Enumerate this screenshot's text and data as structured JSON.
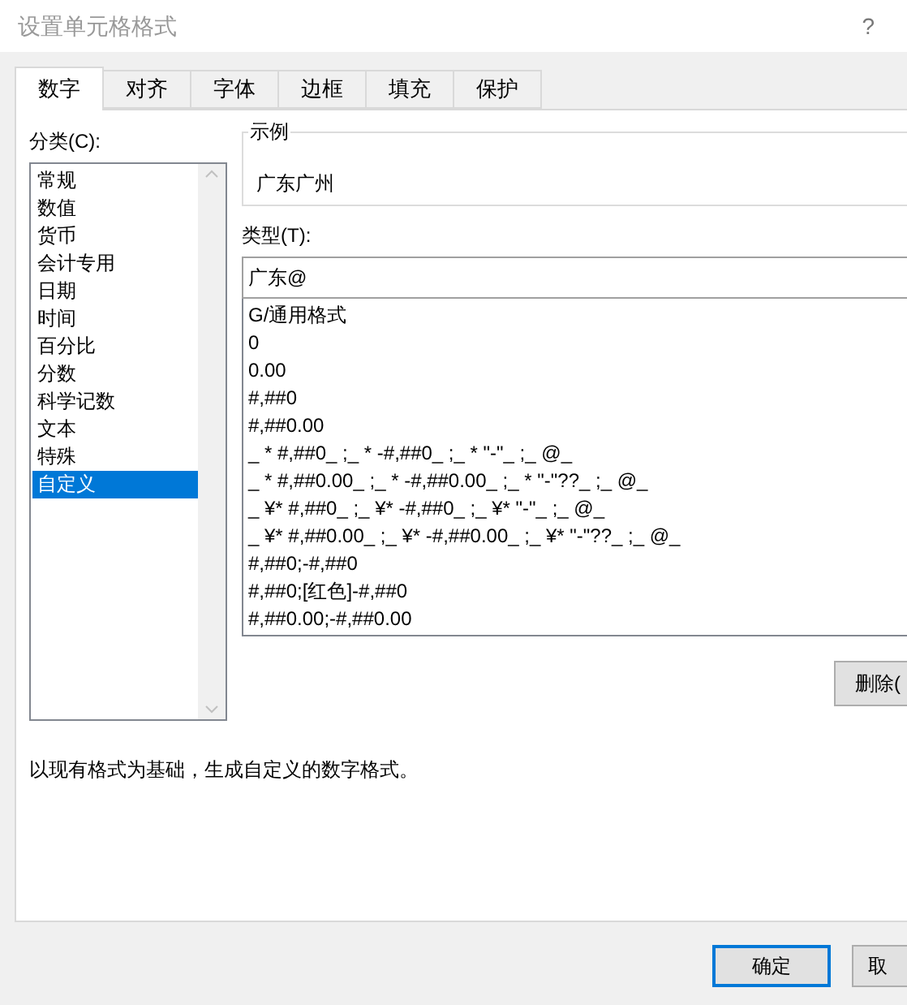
{
  "window": {
    "title": "设置单元格格式",
    "help": "?"
  },
  "tabs": [
    {
      "label": "数字",
      "selected": true
    },
    {
      "label": "对齐",
      "selected": false
    },
    {
      "label": "字体",
      "selected": false
    },
    {
      "label": "边框",
      "selected": false
    },
    {
      "label": "填充",
      "selected": false
    },
    {
      "label": "保护",
      "selected": false
    }
  ],
  "category": {
    "label": "分类(C):",
    "items": [
      {
        "label": "常规",
        "selected": false
      },
      {
        "label": "数值",
        "selected": false
      },
      {
        "label": "货币",
        "selected": false
      },
      {
        "label": "会计专用",
        "selected": false
      },
      {
        "label": "日期",
        "selected": false
      },
      {
        "label": "时间",
        "selected": false
      },
      {
        "label": "百分比",
        "selected": false
      },
      {
        "label": "分数",
        "selected": false
      },
      {
        "label": "科学记数",
        "selected": false
      },
      {
        "label": "文本",
        "selected": false
      },
      {
        "label": "特殊",
        "selected": false
      },
      {
        "label": "自定义",
        "selected": true
      }
    ]
  },
  "sample": {
    "legend": "示例",
    "value": "广东广州"
  },
  "type": {
    "label": "类型(T):",
    "value": "广东@",
    "formats": [
      "G/通用格式",
      "0",
      "0.00",
      "#,##0",
      "#,##0.00",
      "_ * #,##0_ ;_ * -#,##0_ ;_ * \"-\"_ ;_ @_",
      "_ * #,##0.00_ ;_ * -#,##0.00_ ;_ * \"-\"??_ ;_ @_",
      "_ ¥* #,##0_ ;_ ¥* -#,##0_ ;_ ¥* \"-\"_ ;_ @_",
      "_ ¥* #,##0.00_ ;_ ¥* -#,##0.00_ ;_ ¥* \"-\"??_ ;_ @_",
      "#,##0;-#,##0",
      "#,##0;[红色]-#,##0",
      "#,##0.00;-#,##0.00"
    ]
  },
  "delete_button": "删除(",
  "description": "以现有格式为基础，生成自定义的数字格式。",
  "buttons": [
    {
      "label": "确定",
      "default": true
    },
    {
      "label": "取",
      "default": false
    }
  ]
}
